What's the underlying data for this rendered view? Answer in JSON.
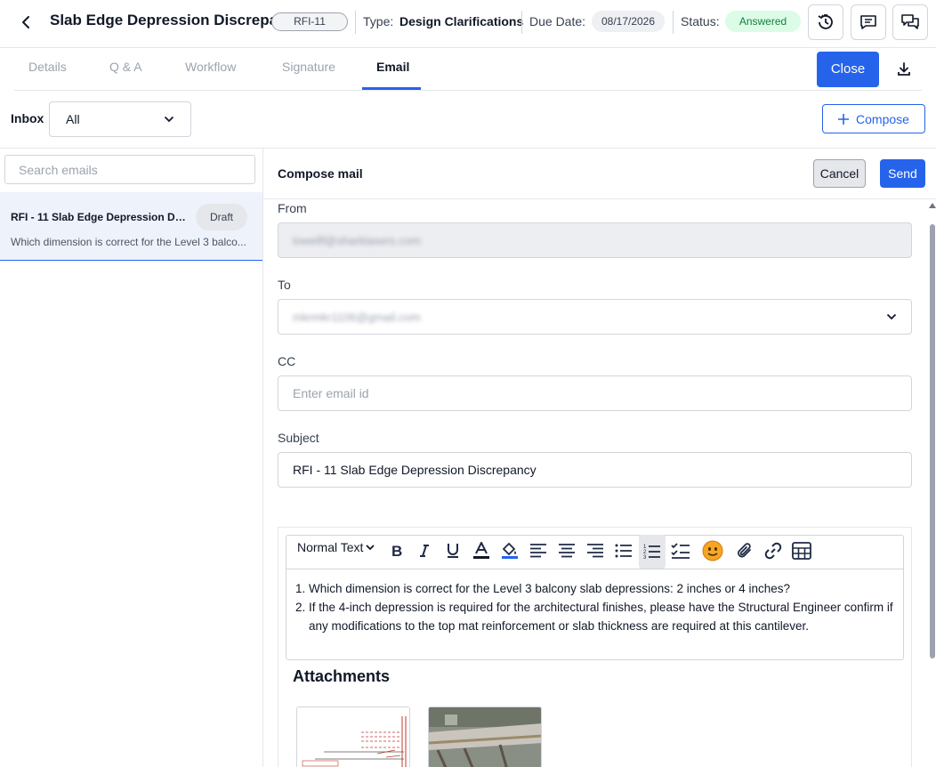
{
  "header": {
    "title": "Slab Edge Depression Discrepan...",
    "rfi_number": "RFI-11",
    "type_label": "Type:",
    "type_value": "Design Clarifications",
    "due_label": "Due Date:",
    "due_value": "08/17/2026",
    "status_label": "Status:",
    "status_value": "Answered"
  },
  "tabs": [
    {
      "label": "Details"
    },
    {
      "label": "Q & A"
    },
    {
      "label": "Workflow"
    },
    {
      "label": "Signature"
    },
    {
      "label": "Email",
      "active": true
    }
  ],
  "actions": {
    "close_label": "Close"
  },
  "inbox": {
    "label": "Inbox",
    "selected": "All",
    "compose_label": "Compose"
  },
  "search": {
    "placeholder": "Search emails"
  },
  "email_list": [
    {
      "subject": "RFI - 11 Slab Edge Depression Disc...",
      "badge": "Draft",
      "preview": "Which dimension is correct for the Level 3 balco..."
    }
  ],
  "compose": {
    "title": "Compose mail",
    "cancel_label": "Cancel",
    "send_label": "Send",
    "from_label": "From",
    "from_value": "lowellf@sharklasers.com",
    "to_label": "To",
    "to_value": "mkrmkr1106@gmail.com",
    "cc_label": "CC",
    "cc_placeholder": "Enter email id",
    "subject_label": "Subject",
    "subject_value": "RFI - 11 Slab Edge Depression Discrepancy"
  },
  "editor": {
    "text_style": "Normal Text",
    "body": [
      "Which dimension is correct for the Level 3 balcony slab depressions: 2 inches or 4 inches?",
      "If the 4-inch depression is required for the architectural finishes, please have the Structural Engineer confirm if any modifications to the top mat reinforcement or slab thickness are required at this cantilever."
    ]
  },
  "attachments": {
    "title": "Attachments"
  },
  "colors": {
    "primary": "#2563eb",
    "answered_bg": "#dcfce7",
    "answered_text": "#15803d"
  }
}
